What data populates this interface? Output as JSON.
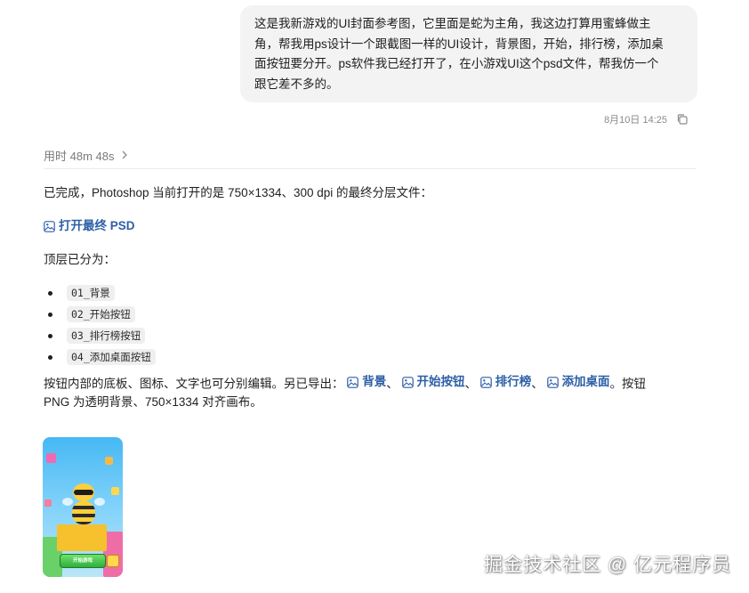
{
  "user_message": {
    "lines": [
      "这是我新游戏的UI封面参考图，它里面是蛇为主角，我这边打算用蜜蜂做主",
      "角，帮我用ps设计一个跟截图一样的UI设计，背景图，开始，排行榜，添加桌",
      "面按钮要分开。ps软件我已经打开了，在小游戏UI这个psd文件，帮我仿一个",
      "跟它差不多的。"
    ],
    "timestamp": "8月10日 14:25"
  },
  "reply": {
    "thinking_label": "用时 48m 48s",
    "intro": "已完成，Photoshop 当前打开的是 750×1334、300 dpi 的最终分层文件：",
    "open_psd_link": "打开最终 PSD",
    "layers_heading": "顶层已分为：",
    "layers": [
      "01_背景",
      "02_开始按钮",
      "03_排行榜按钮",
      "04_添加桌面按钮"
    ],
    "export_prefix": "按钮内部的底板、图标、文字也可分别编辑。另已导出：",
    "export_links": [
      "背景",
      "开始按钮",
      "排行榜",
      "添加桌面"
    ],
    "sep": "、",
    "export_suffix": "。按钮",
    "export_line2": "PNG 为透明背景、750×1334 对齐画布。"
  },
  "thumbnail": {
    "button_text": "开始游戏"
  },
  "watermark": "掘金技术社区 @ 亿元程序员",
  "colors": {
    "link": "#2d5fa6",
    "bubble": "#f3f3f3",
    "code_bg": "#efefef"
  }
}
